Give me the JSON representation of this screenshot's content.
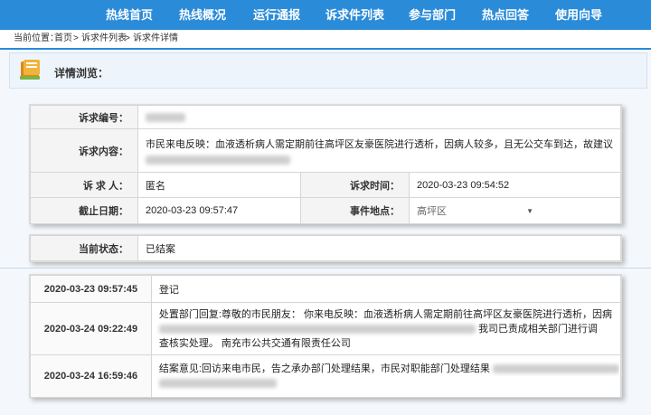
{
  "nav": [
    "热线首页",
    "热线概况",
    "运行通报",
    "诉求件列表",
    "参与部门",
    "热点回答",
    "使用向导"
  ],
  "breadcrumb": {
    "prefix": "当前位置：",
    "home": "首页",
    "sep1": ">",
    "list": "诉求件列表",
    "sep2": ">",
    "detail": "诉求件详情"
  },
  "detail": {
    "title": "详情浏览："
  },
  "info": {
    "id_label": "诉求编号：",
    "content_label": "诉求内容：",
    "content_text": "市民来电反映：血液透析病人需定期前往高坪区友豪医院进行透析，因病人较多，且无公交车到达，故建议",
    "person_label": "诉 求 人：",
    "person_value": "匿名",
    "time_label": "诉求时间：",
    "time_value": "2020-03-23 09:54:52",
    "deadline_label": "截止日期：",
    "deadline_value": "2020-03-23 09:57:47",
    "place_label": "事件地点：",
    "place_value": "高坪区"
  },
  "status": {
    "label": "当前状态：",
    "value": "已结案"
  },
  "timeline": [
    {
      "time": "2020-03-23 09:57:45",
      "text": "登记"
    },
    {
      "time": "2020-03-24 09:22:49",
      "text1": "处置部门回复:尊敬的市民朋友： 你来电反映：血液透析病人需定期前往高坪区友豪医院进行透析，因病",
      "text2": "我司已责成相关部门进行调",
      "text3": "查核实处理。 南充市公共交通有限责任公司"
    },
    {
      "time": "2020-03-24 16:59:46",
      "text1": "结案意见:回访来电市民，告之承办部门处理结果，市民对职能部门处理结果"
    }
  ],
  "colors": {
    "nav": "#2a8bd9",
    "header_bg": "#eef4fb"
  }
}
